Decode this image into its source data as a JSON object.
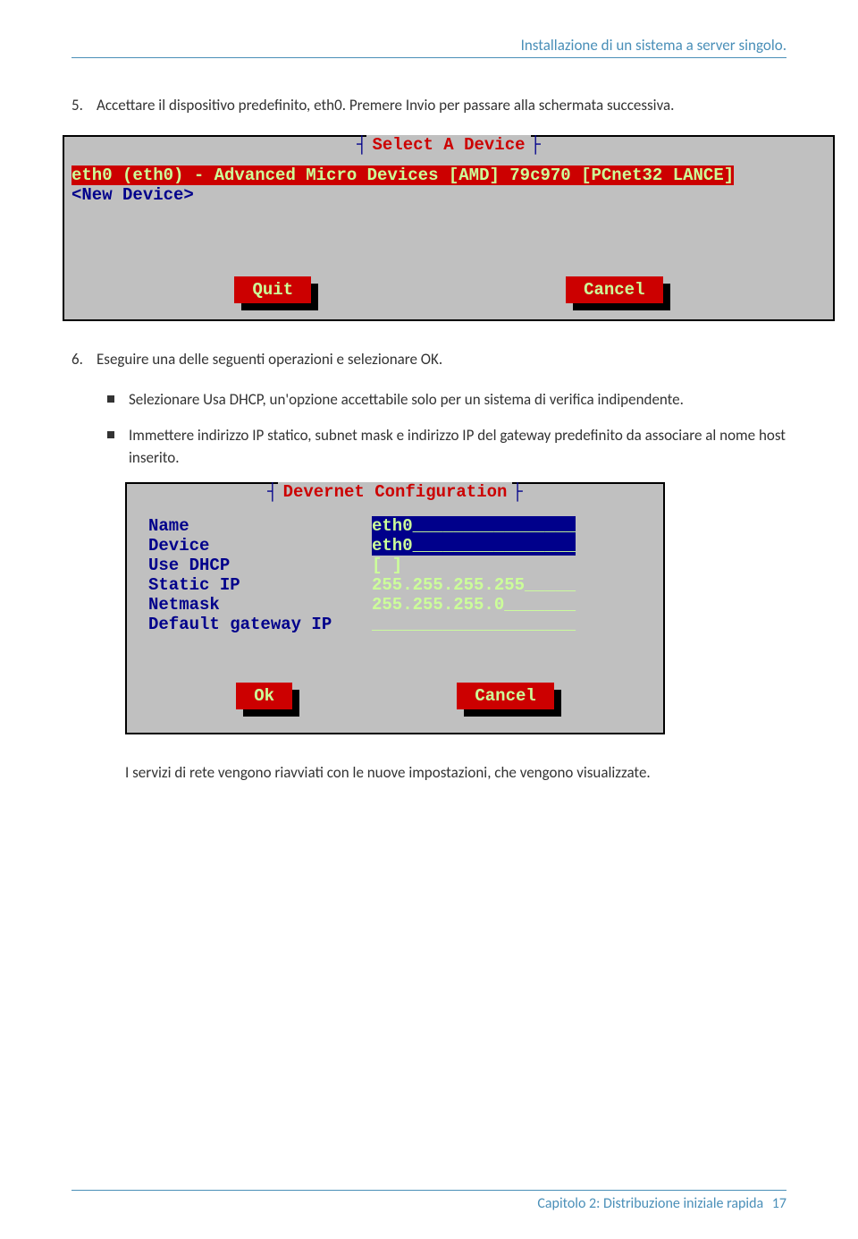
{
  "header": {
    "title": "Installazione di un sistema a server singolo."
  },
  "steps": {
    "s5": {
      "num": "5.",
      "text": "Accettare il dispositivo predefinito, eth0. Premere Invio per passare alla schermata successiva."
    },
    "s6": {
      "num": "6.",
      "text": "Eseguire una delle seguenti operazioni e selezionare OK."
    }
  },
  "bullets": {
    "b1": "Selezionare Usa DHCP, un'opzione accettabile solo per un sistema di verifica indipendente.",
    "b2": "Immettere indirizzo IP statico, subnet mask e indirizzo IP del gateway predefinito da associare al nome host inserito."
  },
  "term1": {
    "title": "Select A Device",
    "row_hl": "eth0 (eth0) - Advanced Micro Devices [AMD] 79c970 [PCnet32 LANCE]",
    "row2": "<New Device>",
    "btn_quit": "Quit",
    "btn_cancel": "Cancel"
  },
  "term2": {
    "title": "Devernet Configuration",
    "rows": [
      {
        "label": "Name",
        "value": "eth0________________",
        "hl": true
      },
      {
        "label": "Device",
        "value": "eth0________________",
        "hl": true
      },
      {
        "label": "Use DHCP",
        "value": "[ ]",
        "hl": false
      },
      {
        "label": "Static IP",
        "value": "255.255.255.255_____",
        "hl": false
      },
      {
        "label": "Netmask",
        "value": "255.255.255.0_______",
        "hl": false
      },
      {
        "label": "Default gateway IP",
        "value": "____________________",
        "hl": false
      }
    ],
    "btn_ok": "Ok",
    "btn_cancel": "Cancel"
  },
  "post_text": "I servizi di rete vengono riavviati con le nuove impostazioni, che vengono visualizzate.",
  "footer": {
    "text": "Capitolo 2: Distribuzione iniziale rapida",
    "page": "17"
  }
}
